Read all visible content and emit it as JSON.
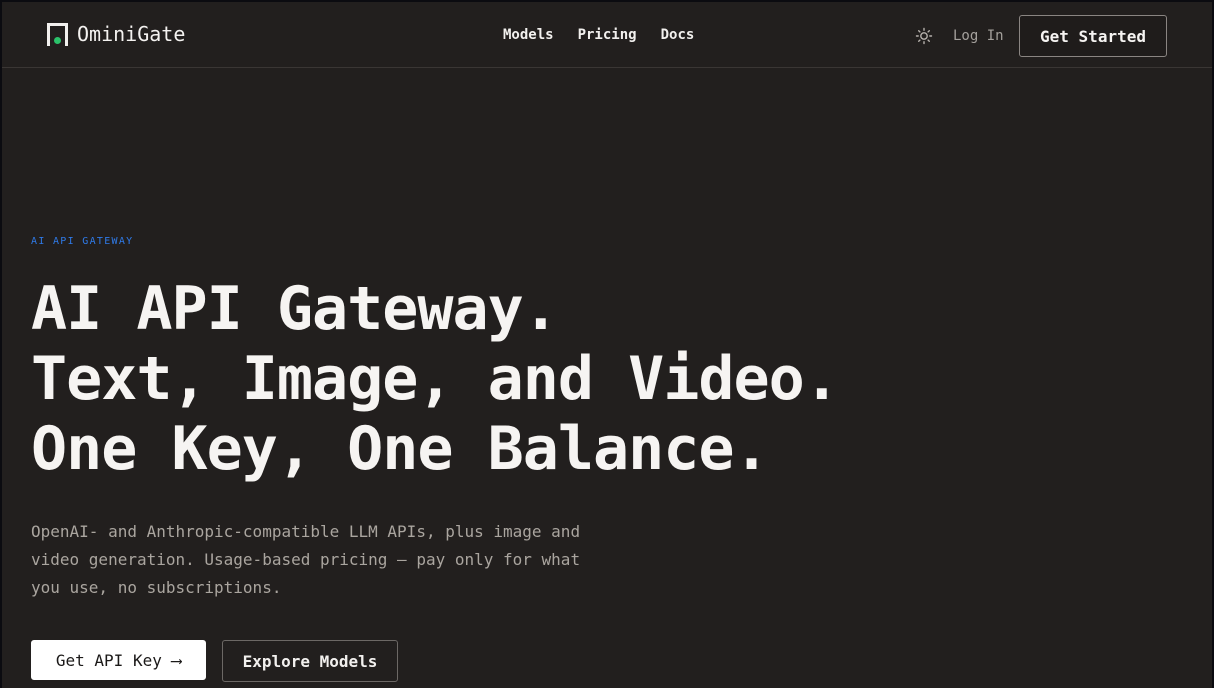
{
  "header": {
    "brand_name": "OminiGate",
    "nav": {
      "models": "Models",
      "pricing": "Pricing",
      "docs": "Docs"
    },
    "theme_icon": "sun-icon",
    "login": "Log In",
    "get_started": "Get Started"
  },
  "hero": {
    "eyebrow": "AI API GATEWAY",
    "headline_1": "AI API Gateway.",
    "headline_2": "Text, Image, and Video.",
    "headline_3": "One Key, One Balance.",
    "description": "OpenAI- and Anthropic-compatible LLM APIs, plus image and video generation. Usage-based pricing — pay only for what you use, no subscriptions.",
    "primary_cta": "Get API Key ⟶",
    "secondary_cta": "Explore Models"
  },
  "colors": {
    "background": "#221f1e",
    "accent": "#2f7ae8",
    "logo_dot": "#2bc26a",
    "text": "#f2f0ee"
  }
}
